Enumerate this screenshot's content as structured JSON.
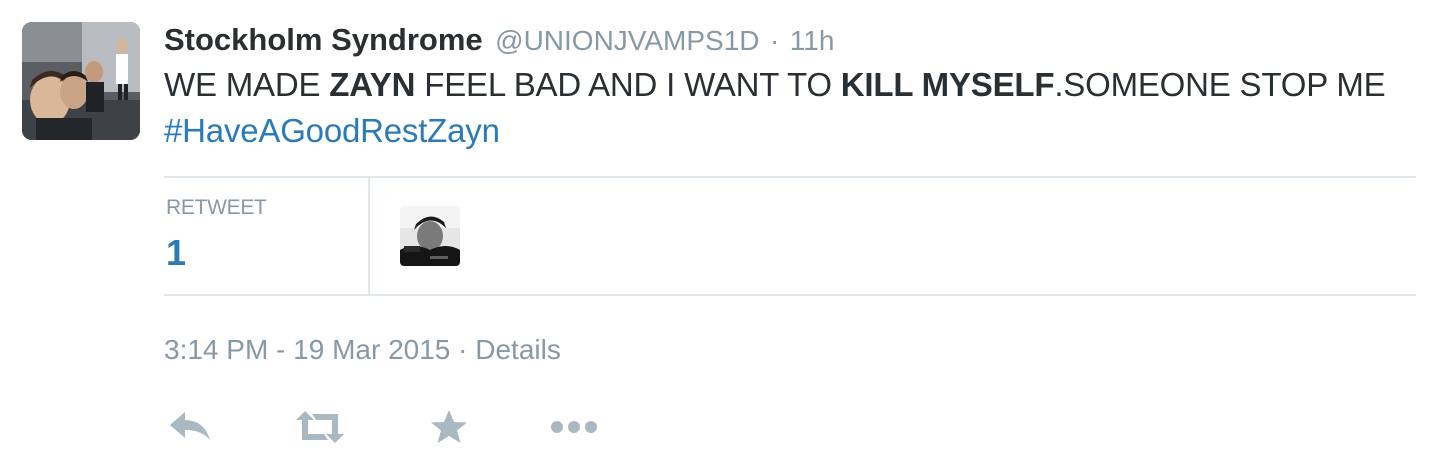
{
  "tweet": {
    "author": {
      "display_name": "Stockholm Syndrome",
      "screen_name": "@UNIONJVAMPS1D",
      "separator": "·",
      "time_ago": "11h"
    },
    "text_segments": [
      {
        "text": "WE MADE ",
        "style": "normal"
      },
      {
        "text": "ZAYN",
        "style": "bold"
      },
      {
        "text": " FEEL BAD AND I WANT TO ",
        "style": "normal"
      },
      {
        "text": "KILL MYSELF",
        "style": "bold"
      },
      {
        "text": ".SOMEONE STOP ME ",
        "style": "normal"
      },
      {
        "text": "#HaveAGoodRestZayn",
        "style": "hashtag"
      }
    ],
    "stats": {
      "retweet_label": "RETWEET",
      "retweet_count": "1"
    },
    "meta": {
      "timestamp": "3:14 PM - 19 Mar 2015",
      "separator": "·",
      "details_label": "Details"
    },
    "actions": [
      {
        "name": "reply",
        "icon": "reply-icon"
      },
      {
        "name": "retweet",
        "icon": "retweet-icon"
      },
      {
        "name": "favorite",
        "icon": "star-icon"
      },
      {
        "name": "more",
        "icon": "more-dots-icon"
      }
    ]
  },
  "colors": {
    "text": "#292f33",
    "muted": "#8899a6",
    "link": "#2b7bb9",
    "border": "#e1e8ed",
    "icon": "#aab8c2"
  }
}
